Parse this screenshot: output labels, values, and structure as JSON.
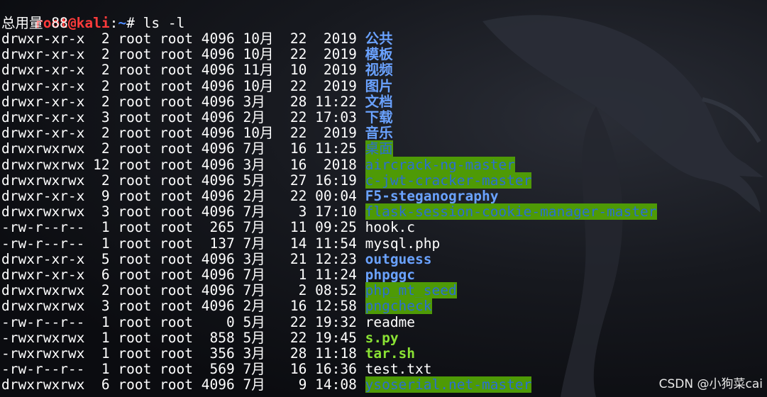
{
  "prompt": {
    "user_host": "root@kali",
    "separator": ":",
    "path": "~",
    "symbol": "# ",
    "command": "ls -l"
  },
  "total_line": "总用量 88",
  "colors": {
    "dir": "#6aa2ff",
    "dir_other_writable_bg": "#4e9a06",
    "dir_other_writable_fg": "#2b6fd0",
    "exec": "#8ae234",
    "file": "#ffffff",
    "prompt_user": "#ff3b3b",
    "prompt_path": "#4f8cff"
  },
  "entries": [
    {
      "meta": "drwxr-xr-x  2 root root 4096 10月  22  2019",
      "name": "公共",
      "kind": "dir"
    },
    {
      "meta": "drwxr-xr-x  2 root root 4096 10月  22  2019",
      "name": "模板",
      "kind": "dir"
    },
    {
      "meta": "drwxr-xr-x  2 root root 4096 11月  10  2019",
      "name": "视频",
      "kind": "dir"
    },
    {
      "meta": "drwxr-xr-x  2 root root 4096 10月  22  2019",
      "name": "图片",
      "kind": "dir"
    },
    {
      "meta": "drwxr-xr-x  2 root root 4096 3月   28 11:22",
      "name": "文档",
      "kind": "dir"
    },
    {
      "meta": "drwxr-xr-x  3 root root 4096 2月   22 17:03",
      "name": "下载",
      "kind": "dir"
    },
    {
      "meta": "drwxr-xr-x  2 root root 4096 10月  22  2019",
      "name": "音乐",
      "kind": "dir"
    },
    {
      "meta": "drwxrwxrwx  2 root root 4096 7月   16 11:25",
      "name": "桌面",
      "kind": "dir-ow"
    },
    {
      "meta": "drwxrwxrwx 12 root root 4096 3月   16  2018",
      "name": "aircrack-ng-master",
      "kind": "dir-ow"
    },
    {
      "meta": "drwxrwxrwx  2 root root 4096 5月   27 16:19",
      "name": "c-jwt-cracker-master",
      "kind": "dir-ow"
    },
    {
      "meta": "drwxr-xr-x  9 root root 4096 2月   22 00:04",
      "name": "F5-steganography",
      "kind": "dir"
    },
    {
      "meta": "drwxrwxrwx  3 root root 4096 7月    3 17:10",
      "name": "flask-session-cookie-manager-master",
      "kind": "dir-ow"
    },
    {
      "meta": "-rw-r--r--  1 root root  265 7月   11 09:25",
      "name": "hook.c",
      "kind": "file"
    },
    {
      "meta": "-rw-r--r--  1 root root  137 7月   14 11:54",
      "name": "mysql.php",
      "kind": "file"
    },
    {
      "meta": "drwxr-xr-x  5 root root 4096 3月   21 12:23",
      "name": "outguess",
      "kind": "dir"
    },
    {
      "meta": "drwxr-xr-x  6 root root 4096 7月    1 11:24",
      "name": "phpggc",
      "kind": "dir"
    },
    {
      "meta": "drwxrwxrwx  2 root root 4096 7月    2 08:52",
      "name": "php_mt_seed",
      "kind": "dir-ow"
    },
    {
      "meta": "drwxrwxrwx  3 root root 4096 2月   16 12:58",
      "name": "pngcheck",
      "kind": "dir-ow"
    },
    {
      "meta": "-rw-r--r--  1 root root    0 5月   22 19:32",
      "name": "readme",
      "kind": "file"
    },
    {
      "meta": "-rwxrwxrwx  1 root root  858 5月   22 19:45",
      "name": "s.py",
      "kind": "exec"
    },
    {
      "meta": "-rwxrwxrwx  1 root root  356 3月   28 11:18",
      "name": "tar.sh",
      "kind": "exec"
    },
    {
      "meta": "-rw-r--r--  1 root root  569 7月   16 16:36",
      "name": "test.txt",
      "kind": "file"
    },
    {
      "meta": "drwxrwxrwx  6 root root 4096 7月    9 14:08",
      "name": "ysoserial.net-master",
      "kind": "dir-ow"
    }
  ],
  "watermark": "CSDN @小狗菜cai"
}
